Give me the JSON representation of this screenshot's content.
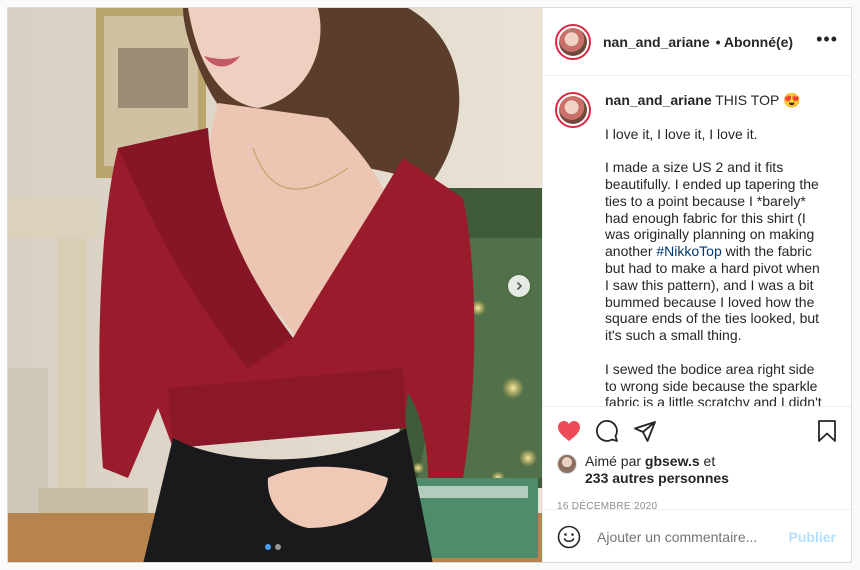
{
  "post": {
    "username": "nan_and_ariane",
    "follow_status": "• Abonné(e)",
    "more_label": "•••"
  },
  "caption": {
    "username": "nan_and_ariane",
    "title": "THIS TOP 😍",
    "p1": "I love it, I love it, I love it.",
    "p2_before": "I made a size US 2 and it fits beautifully. I ended up tapering the ties to a point because I *barely* had enough fabric for this shirt (I was originally planning on making another ",
    "hashtag": "#NikkoTop",
    "p2_after": " with the fabric but had to make a hard pivot when I saw this pattern), and I was a bit bummed because I loved how the square ends of the ties looked, but it's such a small thing.",
    "p3": "I sewed the bodice area right side to wrong side because the sparkle fabric is a little scratchy and I didn't"
  },
  "likes": {
    "prefix": "Aimé par ",
    "user": "gbsew.s",
    "suffix": " et",
    "others": "233 autres personnes"
  },
  "date": "16 DÉCEMBRE 2020",
  "comment": {
    "placeholder": "Ajouter un commentaire...",
    "publish_label": "Publier"
  },
  "colors": {
    "like_red": "#ed4956",
    "link_blue": "#00376b",
    "publish_blue": "#b2dffc"
  },
  "icons": [
    "heart-icon",
    "comment-icon",
    "share-icon",
    "bookmark-icon",
    "emoji-icon",
    "chevron-right-icon",
    "more-icon"
  ],
  "carousel": {
    "current": 1,
    "total": 2
  }
}
